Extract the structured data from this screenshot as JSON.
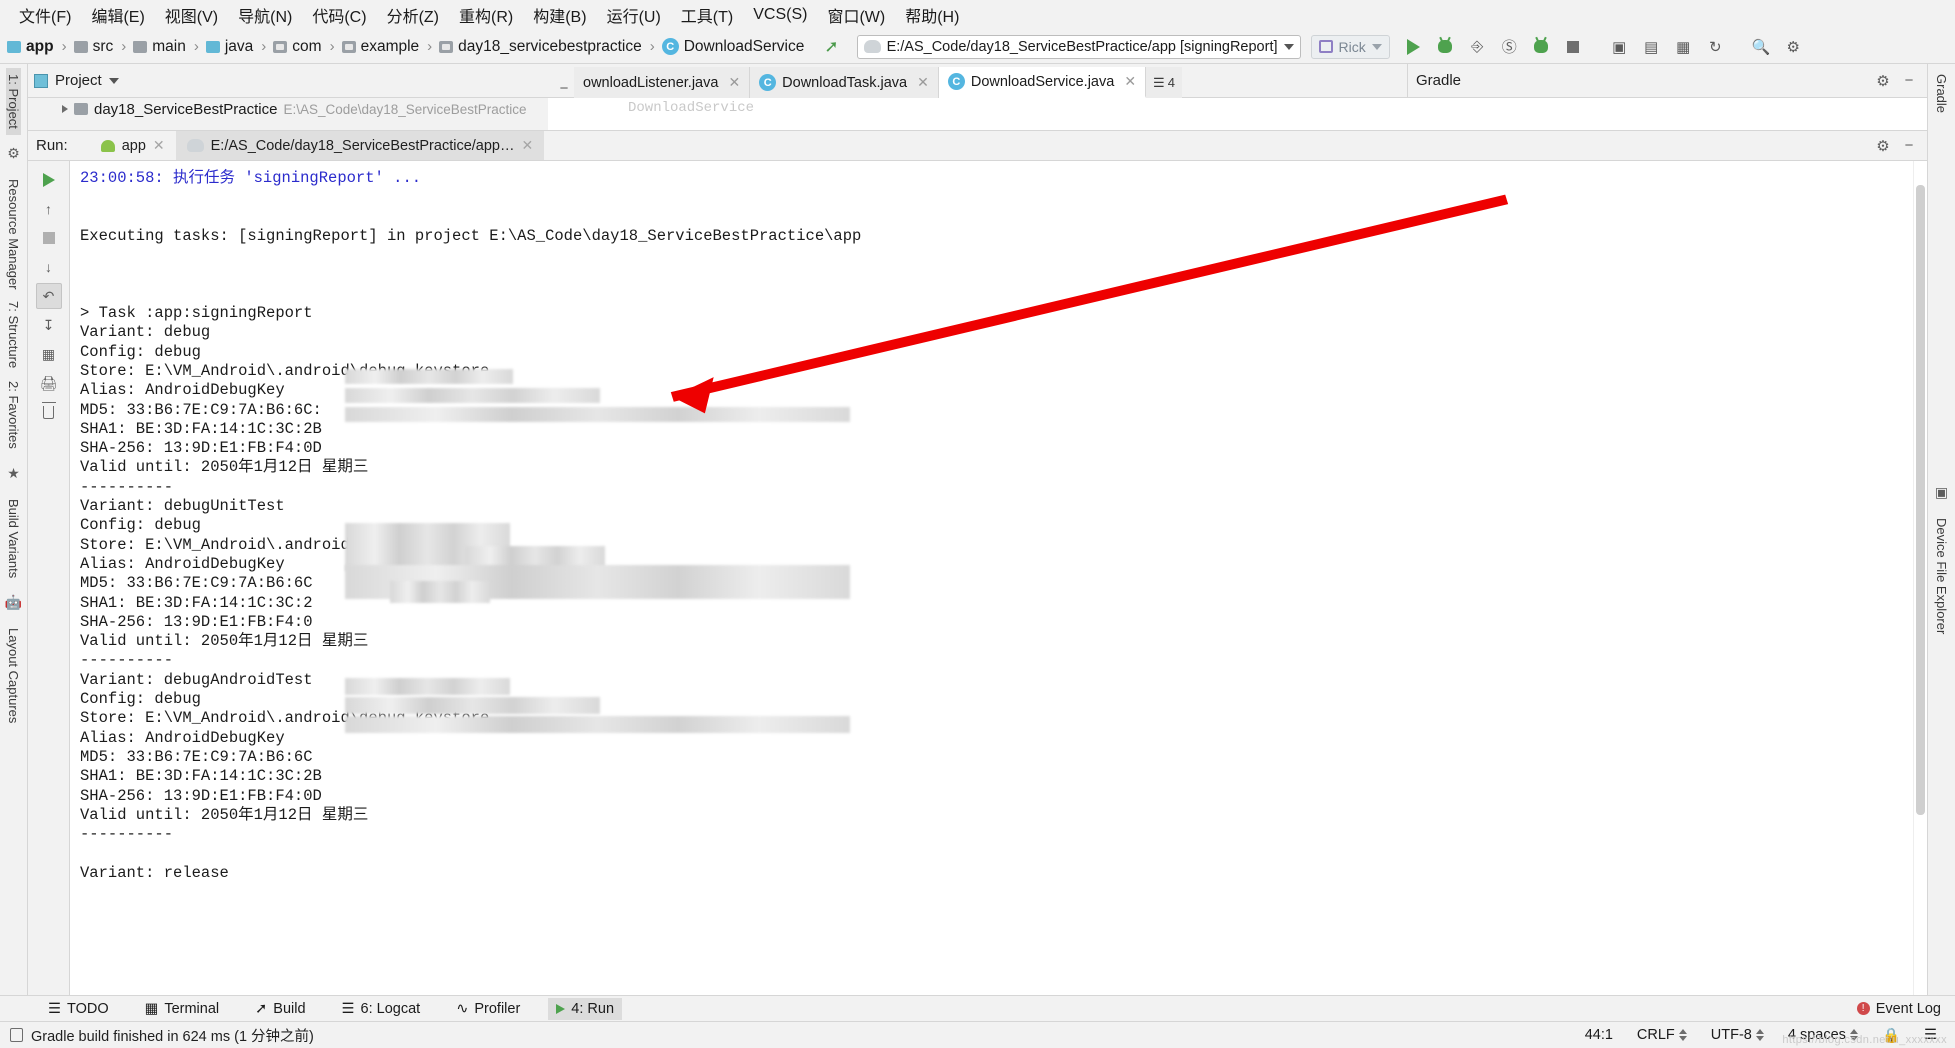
{
  "menubar": {
    "items": [
      {
        "label": "文件(F)",
        "key": "F"
      },
      {
        "label": "编辑(E)",
        "key": "E"
      },
      {
        "label": "视图(V)",
        "key": "V"
      },
      {
        "label": "导航(N)",
        "key": "N"
      },
      {
        "label": "代码(C)",
        "key": "C"
      },
      {
        "label": "分析(Z)",
        "key": "Z"
      },
      {
        "label": "重构(R)",
        "key": "R"
      },
      {
        "label": "构建(B)",
        "key": "B"
      },
      {
        "label": "运行(U)",
        "key": "U"
      },
      {
        "label": "工具(T)",
        "key": "T"
      },
      {
        "label": "VCS(S)",
        "key": "S"
      },
      {
        "label": "窗口(W)",
        "key": "W"
      },
      {
        "label": "帮助(H)",
        "key": "H"
      }
    ]
  },
  "breadcrumb": {
    "items": [
      {
        "label": "app",
        "icon": "module-icon"
      },
      {
        "label": "src",
        "icon": "folder-icon"
      },
      {
        "label": "main",
        "icon": "folder-icon"
      },
      {
        "label": "java",
        "icon": "source-folder-icon"
      },
      {
        "label": "com",
        "icon": "package-icon"
      },
      {
        "label": "example",
        "icon": "package-icon"
      },
      {
        "label": "day18_servicebestpractice",
        "icon": "package-icon"
      },
      {
        "label": "DownloadService",
        "icon": "class-icon"
      }
    ],
    "separator": "›"
  },
  "toolbar": {
    "run_config": "E:/AS_Code/day18_ServiceBestPractice/app [signingReport]",
    "device": "Rick",
    "icons": [
      "run-icon",
      "debug-icon",
      "attach-debugger-icon",
      "coverage-icon",
      "profile-icon",
      "stop-icon",
      "avd-manager-icon",
      "sdk-manager-icon",
      "layout-inspector-icon",
      "sync-gradle-icon",
      "search-icon",
      "settings-icon"
    ]
  },
  "project_panel": {
    "title": "Project",
    "tree_row": {
      "label": "day18_ServiceBestPractice",
      "path": "E:\\AS_Code\\day18_ServiceBestPractice"
    },
    "icons": [
      "locate-icon",
      "collapse-all-icon",
      "gear-icon",
      "minimize-icon"
    ]
  },
  "editor_tabs": [
    {
      "label": "ownloadListener.java",
      "icon": "interface-icon",
      "active": false
    },
    {
      "label": "DownloadTask.java",
      "icon": "class-icon",
      "active": false
    },
    {
      "label": "DownloadService.java",
      "icon": "class-icon",
      "active": true
    }
  ],
  "editor_tab_overflow": "4",
  "ghost_editor_text": "DownloadService",
  "gradle_panel": {
    "title": "Gradle",
    "icons": [
      "gear-icon",
      "minimize-icon"
    ]
  },
  "run_panel": {
    "label": "Run:",
    "tabs": [
      {
        "label": "app",
        "icon": "android-icon",
        "selected": false
      },
      {
        "label": "E:/AS_Code/day18_ServiceBestPractice/app…",
        "icon": "gradle-icon",
        "selected": true
      }
    ],
    "gutter_icons": [
      "rerun-icon",
      "stop-icon",
      "scroll-up-icon",
      "soft-wrap-icon",
      "scroll-to-end-icon",
      "grid-icon",
      "print-icon",
      "clear-all-icon"
    ],
    "console_lines": [
      {
        "text": "23:00:58: 执行任务 'signingReport' ...",
        "style": "blue"
      },
      {
        "text": "",
        "style": "blank"
      },
      {
        "text": "",
        "style": "blank"
      },
      {
        "text": "Executing tasks: [signingReport] in project E:\\AS_Code\\day18_ServiceBestPractice\\app",
        "style": "plain"
      },
      {
        "text": "",
        "style": "blank"
      },
      {
        "text": "",
        "style": "blank"
      },
      {
        "text": "",
        "style": "blank"
      },
      {
        "text": "> Task :app:signingReport",
        "style": "plain"
      },
      {
        "text": "Variant: debug",
        "style": "plain"
      },
      {
        "text": "Config: debug",
        "style": "plain"
      },
      {
        "text": "Store: E:\\VM_Android\\.android\\debug.keystore",
        "style": "plain"
      },
      {
        "text": "Alias: AndroidDebugKey",
        "style": "plain"
      },
      {
        "text": "MD5: 33:B6:7E:C9:7A:B6:6C:",
        "style": "plain"
      },
      {
        "text": "SHA1: BE:3D:FA:14:1C:3C:2B",
        "style": "plain"
      },
      {
        "text": "SHA-256: 13:9D:E1:FB:F4:0D",
        "style": "plain"
      },
      {
        "text": "Valid until: 2050年1月12日 星期三",
        "style": "plain"
      },
      {
        "text": "----------",
        "style": "plain"
      },
      {
        "text": "Variant: debugUnitTest",
        "style": "plain"
      },
      {
        "text": "Config: debug",
        "style": "plain"
      },
      {
        "text": "Store: E:\\VM_Android\\.android\\debug.keystore",
        "style": "plain"
      },
      {
        "text": "Alias: AndroidDebugKey",
        "style": "plain"
      },
      {
        "text": "MD5: 33:B6:7E:C9:7A:B6:6C",
        "style": "plain"
      },
      {
        "text": "SHA1: BE:3D:FA:14:1C:3C:2",
        "style": "plain"
      },
      {
        "text": "SHA-256: 13:9D:E1:FB:F4:0",
        "style": "plain"
      },
      {
        "text": "Valid until: 2050年1月12日 星期三",
        "style": "plain"
      },
      {
        "text": "----------",
        "style": "plain"
      },
      {
        "text": "Variant: debugAndroidTest",
        "style": "plain"
      },
      {
        "text": "Config: debug",
        "style": "plain"
      },
      {
        "text": "Store: E:\\VM_Android\\.android\\debug.keystore",
        "style": "plain"
      },
      {
        "text": "Alias: AndroidDebugKey",
        "style": "plain"
      },
      {
        "text": "MD5: 33:B6:7E:C9:7A:B6:6C",
        "style": "plain"
      },
      {
        "text": "SHA1: BE:3D:FA:14:1C:3C:2B",
        "style": "plain"
      },
      {
        "text": "SHA-256: 13:9D:E1:FB:F4:0D",
        "style": "plain"
      },
      {
        "text": "Valid until: 2050年1月12日 星期三",
        "style": "plain"
      },
      {
        "text": "----------",
        "style": "plain"
      },
      {
        "text": "",
        "style": "blank"
      },
      {
        "text": "Variant: release",
        "style": "plain"
      }
    ]
  },
  "left_rail": {
    "items": [
      {
        "label": "1: Project"
      },
      {
        "label": "Resource Manager"
      },
      {
        "label": "7: Structure"
      },
      {
        "label": "2: Favorites"
      },
      {
        "label": "Build Variants"
      },
      {
        "label": "Layout Captures"
      }
    ]
  },
  "right_rail": {
    "items": [
      {
        "label": "Gradle"
      },
      {
        "label": "Device File Explorer"
      }
    ]
  },
  "bottom_bar": {
    "items": [
      {
        "label": "TODO",
        "icon": "todo-icon",
        "selected": false
      },
      {
        "label": "Terminal",
        "icon": "terminal-icon",
        "selected": false
      },
      {
        "label": "Build",
        "icon": "build-icon",
        "selected": false
      },
      {
        "label": "6: Logcat",
        "icon": "logcat-icon",
        "selected": false
      },
      {
        "label": "Profiler",
        "icon": "profiler-icon",
        "selected": false
      },
      {
        "label": "4: Run",
        "icon": "run-icon",
        "selected": true
      }
    ],
    "event_log": "Event Log"
  },
  "status_bar": {
    "message": "Gradle build finished in 624 ms (1 分钟之前)",
    "caret": "44:1",
    "line_separator": "CRLF",
    "encoding": "UTF-8",
    "indent": "4 spaces"
  },
  "watermark": "https://blog.csdn.net/u_xxxxxxx",
  "colors": {
    "accent_green": "#4ea24e",
    "class_blue": "#54b6e0",
    "console_blue": "#2b2bcc",
    "annotation_red": "#ee0000",
    "panel_bg": "#f2f2f2"
  }
}
